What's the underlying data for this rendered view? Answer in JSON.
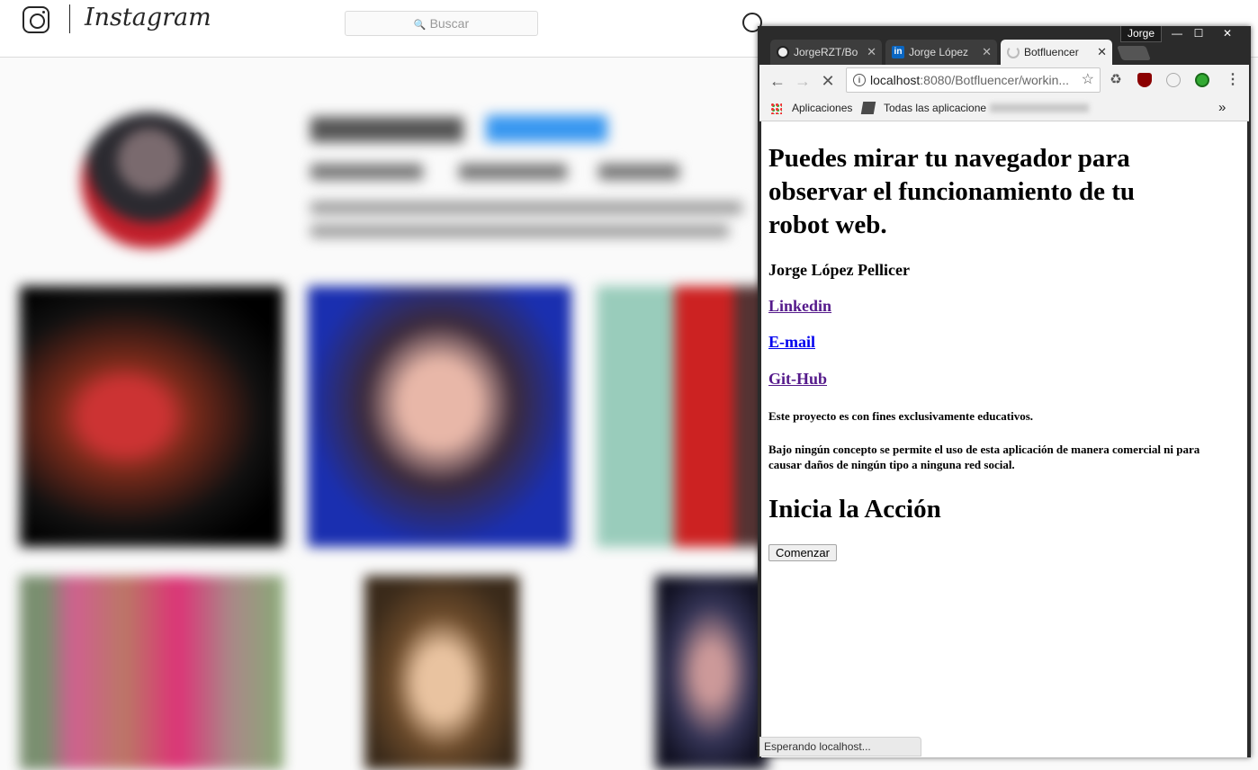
{
  "instagram": {
    "brand": "Instagram",
    "search_placeholder": "Buscar"
  },
  "browser": {
    "profile_name": "Jorge",
    "window_controls": {
      "minimize": "—",
      "maximize": "☐",
      "close": "✕"
    },
    "tabs": [
      {
        "label": "JorgeRZT/Bo",
        "icon": "github-icon"
      },
      {
        "label": "Jorge López",
        "icon": "linkedin-icon"
      },
      {
        "label": "Botfluencer",
        "icon": "loading-icon",
        "active": true
      }
    ],
    "address": {
      "host": "localhost",
      "path": ":8080/Botfluencer/workin..."
    },
    "bookmarks": {
      "apps": "Aplicaciones",
      "all_apps": "Todas las aplicacione",
      "overflow": "»"
    },
    "status_text": "Esperando localhost..."
  },
  "page": {
    "heading": "Puedes mirar tu navegador para observar el funcionamiento de tu robot web.",
    "author": "Jorge López Pellicer",
    "links": {
      "linkedin": "Linkedin",
      "email": "E-mail",
      "github": "Git-Hub"
    },
    "disclaimer_1": "Este proyecto es con fines exclusivamente educativos.",
    "disclaimer_2": "Bajo ningún concepto se permite el uso de esta aplicación de manera comercial ni para causar daños de ningún tipo a ninguna red social.",
    "action_heading": "Inicia la Acción",
    "start_button": "Comenzar"
  }
}
